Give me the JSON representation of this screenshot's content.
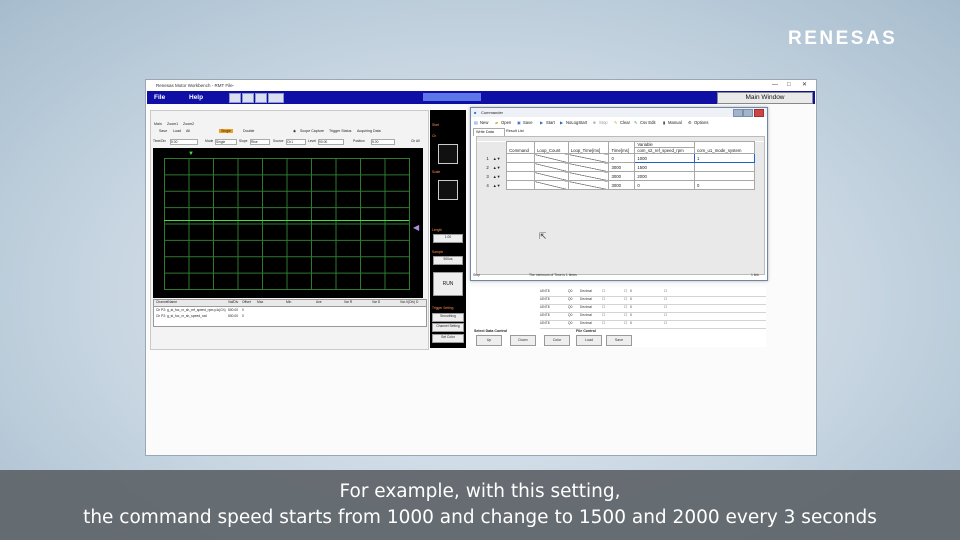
{
  "brand": "RENESAS",
  "app": {
    "title": "Renesas Motor Workbench    - RMT File-",
    "menu": [
      "File",
      "Help"
    ],
    "main_window_button": "Main Window"
  },
  "scope": {
    "tabs": [
      "Main",
      "Zoom1",
      "Zoom2"
    ],
    "row1": {
      "save": "Save",
      "load": "Load",
      "all": "All",
      "single": "Single",
      "double": "Double",
      "scope_capture": "Scope Capture",
      "trigger_status": "Trigger Status",
      "acquiring_data": "Acquiring Data"
    },
    "row2": {
      "time_div_label": "Time/Div",
      "time_div_value": "5.00",
      "mode_label": "Mode",
      "mode_value": "Single",
      "slope_label": "Slope",
      "slope_value": "Rise",
      "source_label": "Source",
      "source_value": "Ch1",
      "level_label": "Level",
      "level_value": "90.00",
      "position_label": "Position",
      "position_value": "5.00",
      "ch_all": "Ch All"
    },
    "channel_table": {
      "headers": [
        "ChannelName",
        "Val/Div",
        "Offset",
        "Max",
        "Min",
        "Ave",
        "Var R",
        "Var D",
        "Var-V(Div) D"
      ],
      "rows": [
        [
          "Ch P2: g_st_foc_vr_sh_ref_speed_rpm.y.lo(Ch)",
          "500.00",
          "0"
        ],
        [
          "Ch P2: g_st_foc_vr_sh_speed_rad",
          "500.00",
          "0"
        ]
      ]
    },
    "right_controls": {
      "ch_label": "Ch",
      "scale_label": "Scale",
      "length_label": "Length",
      "length_value": "1.00",
      "sample_label": "Sample",
      "sample_value": "500us",
      "run": "RUN",
      "trigger_setting_label": "Trigger Setting",
      "smoothing": "Smoothing",
      "channel_setting": "Channel Setting",
      "set_color": "Set Color",
      "start_label": "Start"
    }
  },
  "variable_table_bg": {
    "rows": [
      [
        "UINT8",
        "Q0",
        "Decimal",
        "0"
      ],
      [
        "UINT8",
        "Q0",
        "Decimal",
        "0"
      ],
      [
        "UINT8",
        "Q0",
        "Decimal",
        "0"
      ],
      [
        "UINT8",
        "Q0",
        "Decimal",
        "0"
      ],
      [
        "UINT8",
        "Q0",
        "Decimal",
        "0"
      ]
    ],
    "select_data_control": "Select Data Control",
    "file_control": "File Control",
    "buttons": [
      "Up",
      "Down",
      "Color",
      "Load",
      "Save"
    ]
  },
  "commander": {
    "title": "Commander",
    "toolbar": [
      "New",
      "Open",
      "Save",
      "Start",
      "NoLogStart",
      "Stop",
      "Clear",
      "Csv Edit",
      "Manual",
      "Options"
    ],
    "tabs": [
      "Write Data",
      "Result List"
    ],
    "columns": [
      "Command",
      "Loop_Count",
      "Loop_Time[ms]",
      "Time[ms]",
      "Variable",
      "com_s2_ref_speed_rpm",
      "com_u1_mode_system"
    ],
    "rows": [
      {
        "n": "1",
        "time": "0",
        "speed": "1000",
        "mode": "1"
      },
      {
        "n": "2",
        "time": "3000",
        "speed": "1500",
        "mode": ""
      },
      {
        "n": "3",
        "time": "3000",
        "speed": "2000",
        "mode": ""
      },
      {
        "n": "4",
        "time": "3000",
        "speed": "0",
        "mode": "0"
      }
    ],
    "status_left": "Stop",
    "status_mid": "The minimum of Time is 1 times",
    "status_right": "1 link"
  },
  "caption": {
    "line1": "For example, with this setting,",
    "line2": "the command speed starts from 1000 and change to 1500 and 2000 every 3 seconds"
  }
}
